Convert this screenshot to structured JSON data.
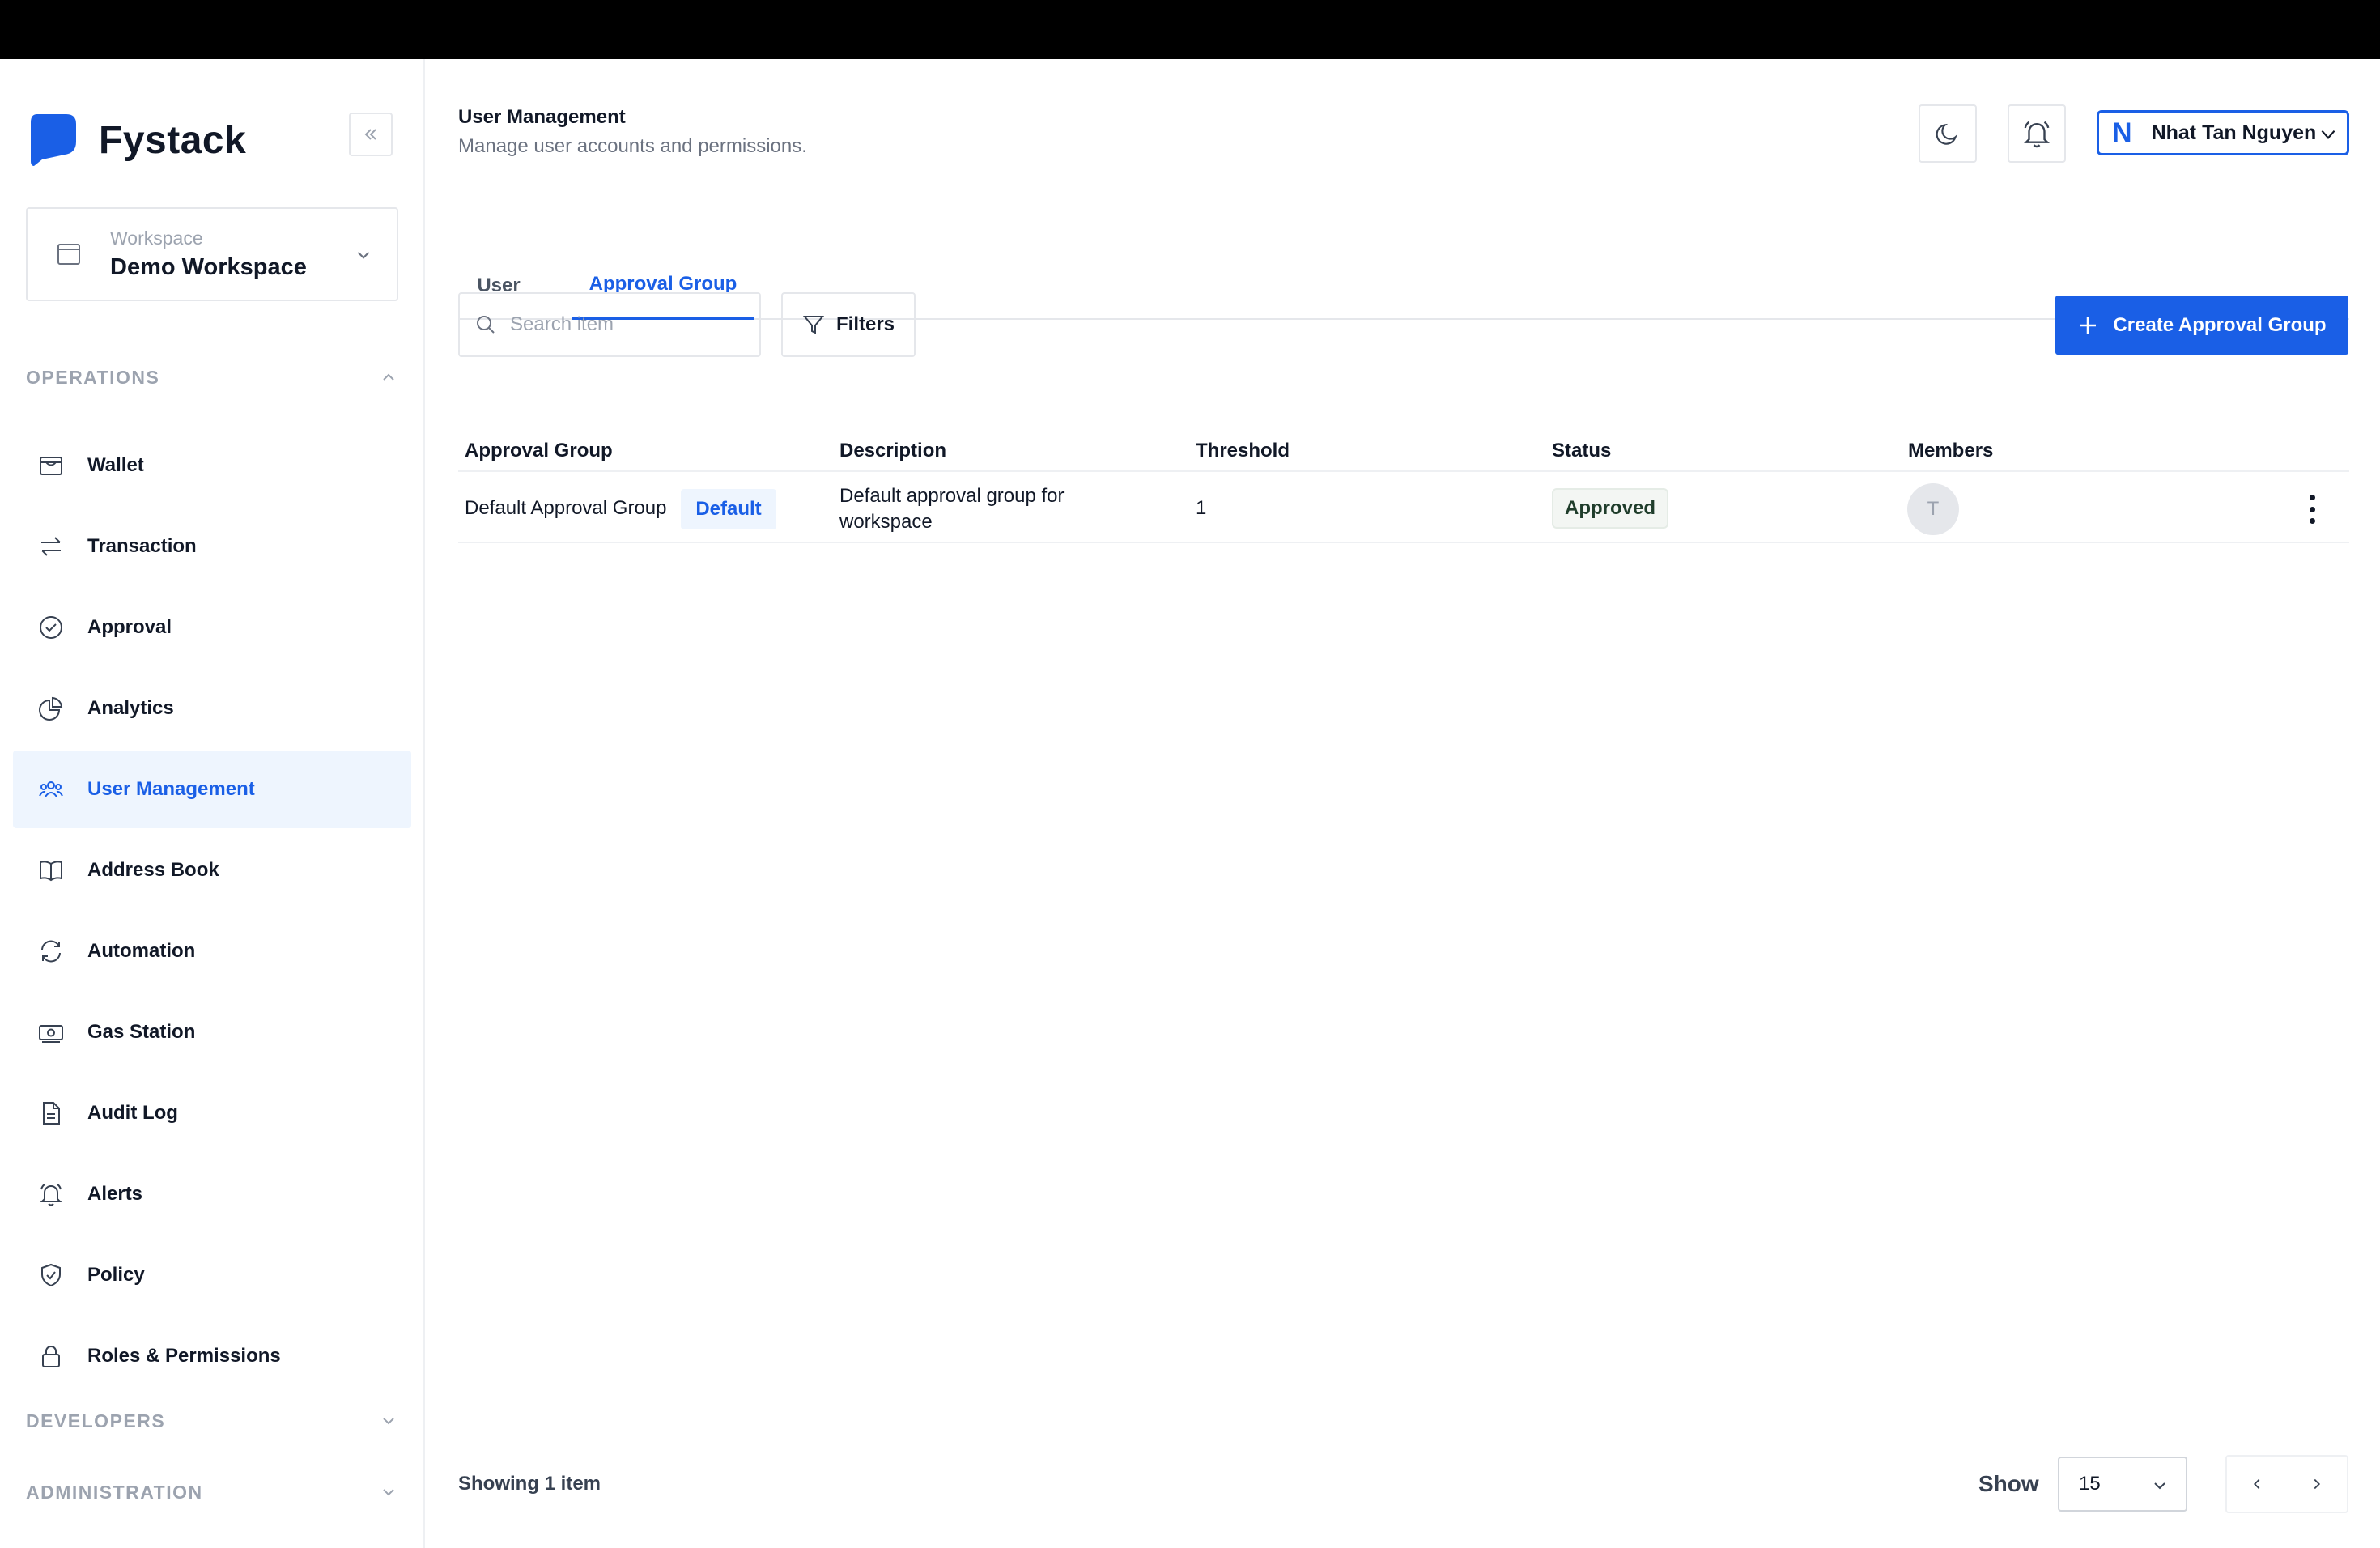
{
  "brand": {
    "name": "Fystack",
    "accent": "#1a5fe6"
  },
  "workspace": {
    "label": "Workspace",
    "name": "Demo Workspace"
  },
  "sidebar": {
    "sections": [
      {
        "title": "OPERATIONS",
        "expanded": true
      },
      {
        "title": "DEVELOPERS",
        "expanded": false
      },
      {
        "title": "ADMINISTRATION",
        "expanded": false
      }
    ],
    "items": [
      {
        "label": "Wallet",
        "icon": "wallet-icon"
      },
      {
        "label": "Transaction",
        "icon": "transfer-arrows-icon"
      },
      {
        "label": "Approval",
        "icon": "check-circle-icon"
      },
      {
        "label": "Analytics",
        "icon": "pie-chart-icon"
      },
      {
        "label": "User Management",
        "icon": "users-icon",
        "active": true
      },
      {
        "label": "Address Book",
        "icon": "book-icon"
      },
      {
        "label": "Automation",
        "icon": "refresh-icon"
      },
      {
        "label": "Gas Station",
        "icon": "banknote-icon"
      },
      {
        "label": "Audit Log",
        "icon": "document-icon"
      },
      {
        "label": "Alerts",
        "icon": "bell-icon"
      },
      {
        "label": "Policy",
        "icon": "shield-check-icon"
      },
      {
        "label": "Roles & Permissions",
        "icon": "lock-icon"
      }
    ]
  },
  "header": {
    "title": "User Management",
    "subtitle": "Manage user accounts and permissions.",
    "user": {
      "initial": "N",
      "name": "Nhat Tan Nguyen"
    }
  },
  "tabs": [
    {
      "label": "User",
      "active": false
    },
    {
      "label": "Approval Group",
      "active": true
    }
  ],
  "toolbar": {
    "search_placeholder": "Search item",
    "filters_label": "Filters",
    "create_label": "Create Approval Group"
  },
  "table": {
    "columns": [
      "Approval Group",
      "Description",
      "Threshold",
      "Status",
      "Members"
    ],
    "rows": [
      {
        "name": "Default Approval Group",
        "badge": "Default",
        "description_line1": "Default approval group for",
        "description_line2": "workspace",
        "threshold": "1",
        "status": "Approved",
        "member_initial": "T"
      }
    ]
  },
  "footer": {
    "showing": "Showing 1 item",
    "show_label": "Show",
    "page_size": "15"
  }
}
